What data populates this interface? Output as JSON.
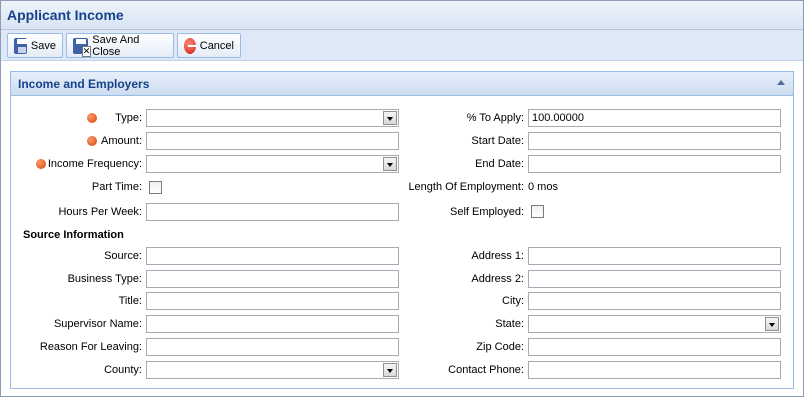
{
  "window": {
    "title": "Applicant Income"
  },
  "toolbar": {
    "save": "Save",
    "save_and_close": "Save And Close",
    "cancel": "Cancel"
  },
  "panel": {
    "title": "Income and Employers"
  },
  "left": {
    "type_label": "Type:",
    "amount_label": "Amount:",
    "income_frequency_label": "Income Frequency:",
    "part_time_label": "Part Time:",
    "hours_per_week_label": "Hours Per Week:"
  },
  "right": {
    "percent_to_apply_label": "% To Apply:",
    "percent_to_apply_value": "100.00000",
    "start_date_label": "Start Date:",
    "end_date_label": "End Date:",
    "length_of_employment_label": "Length Of Employment:",
    "length_of_employment_value": "0 mos",
    "self_employed_label": "Self Employed:"
  },
  "source": {
    "heading": "Source Information",
    "source_label": "Source:",
    "business_type_label": "Business Type:",
    "title_label": "Title:",
    "supervisor_name_label": "Supervisor Name:",
    "reason_for_leaving_label": "Reason For Leaving:",
    "county_label": "County:",
    "address1_label": "Address 1:",
    "address2_label": "Address 2:",
    "city_label": "City:",
    "state_label": "State:",
    "zip_code_label": "Zip Code:",
    "contact_phone_label": "Contact Phone:"
  },
  "colors": {
    "title_text": "#15428b",
    "required_marker": "#d0440e",
    "panel_border": "#99bbe8"
  }
}
